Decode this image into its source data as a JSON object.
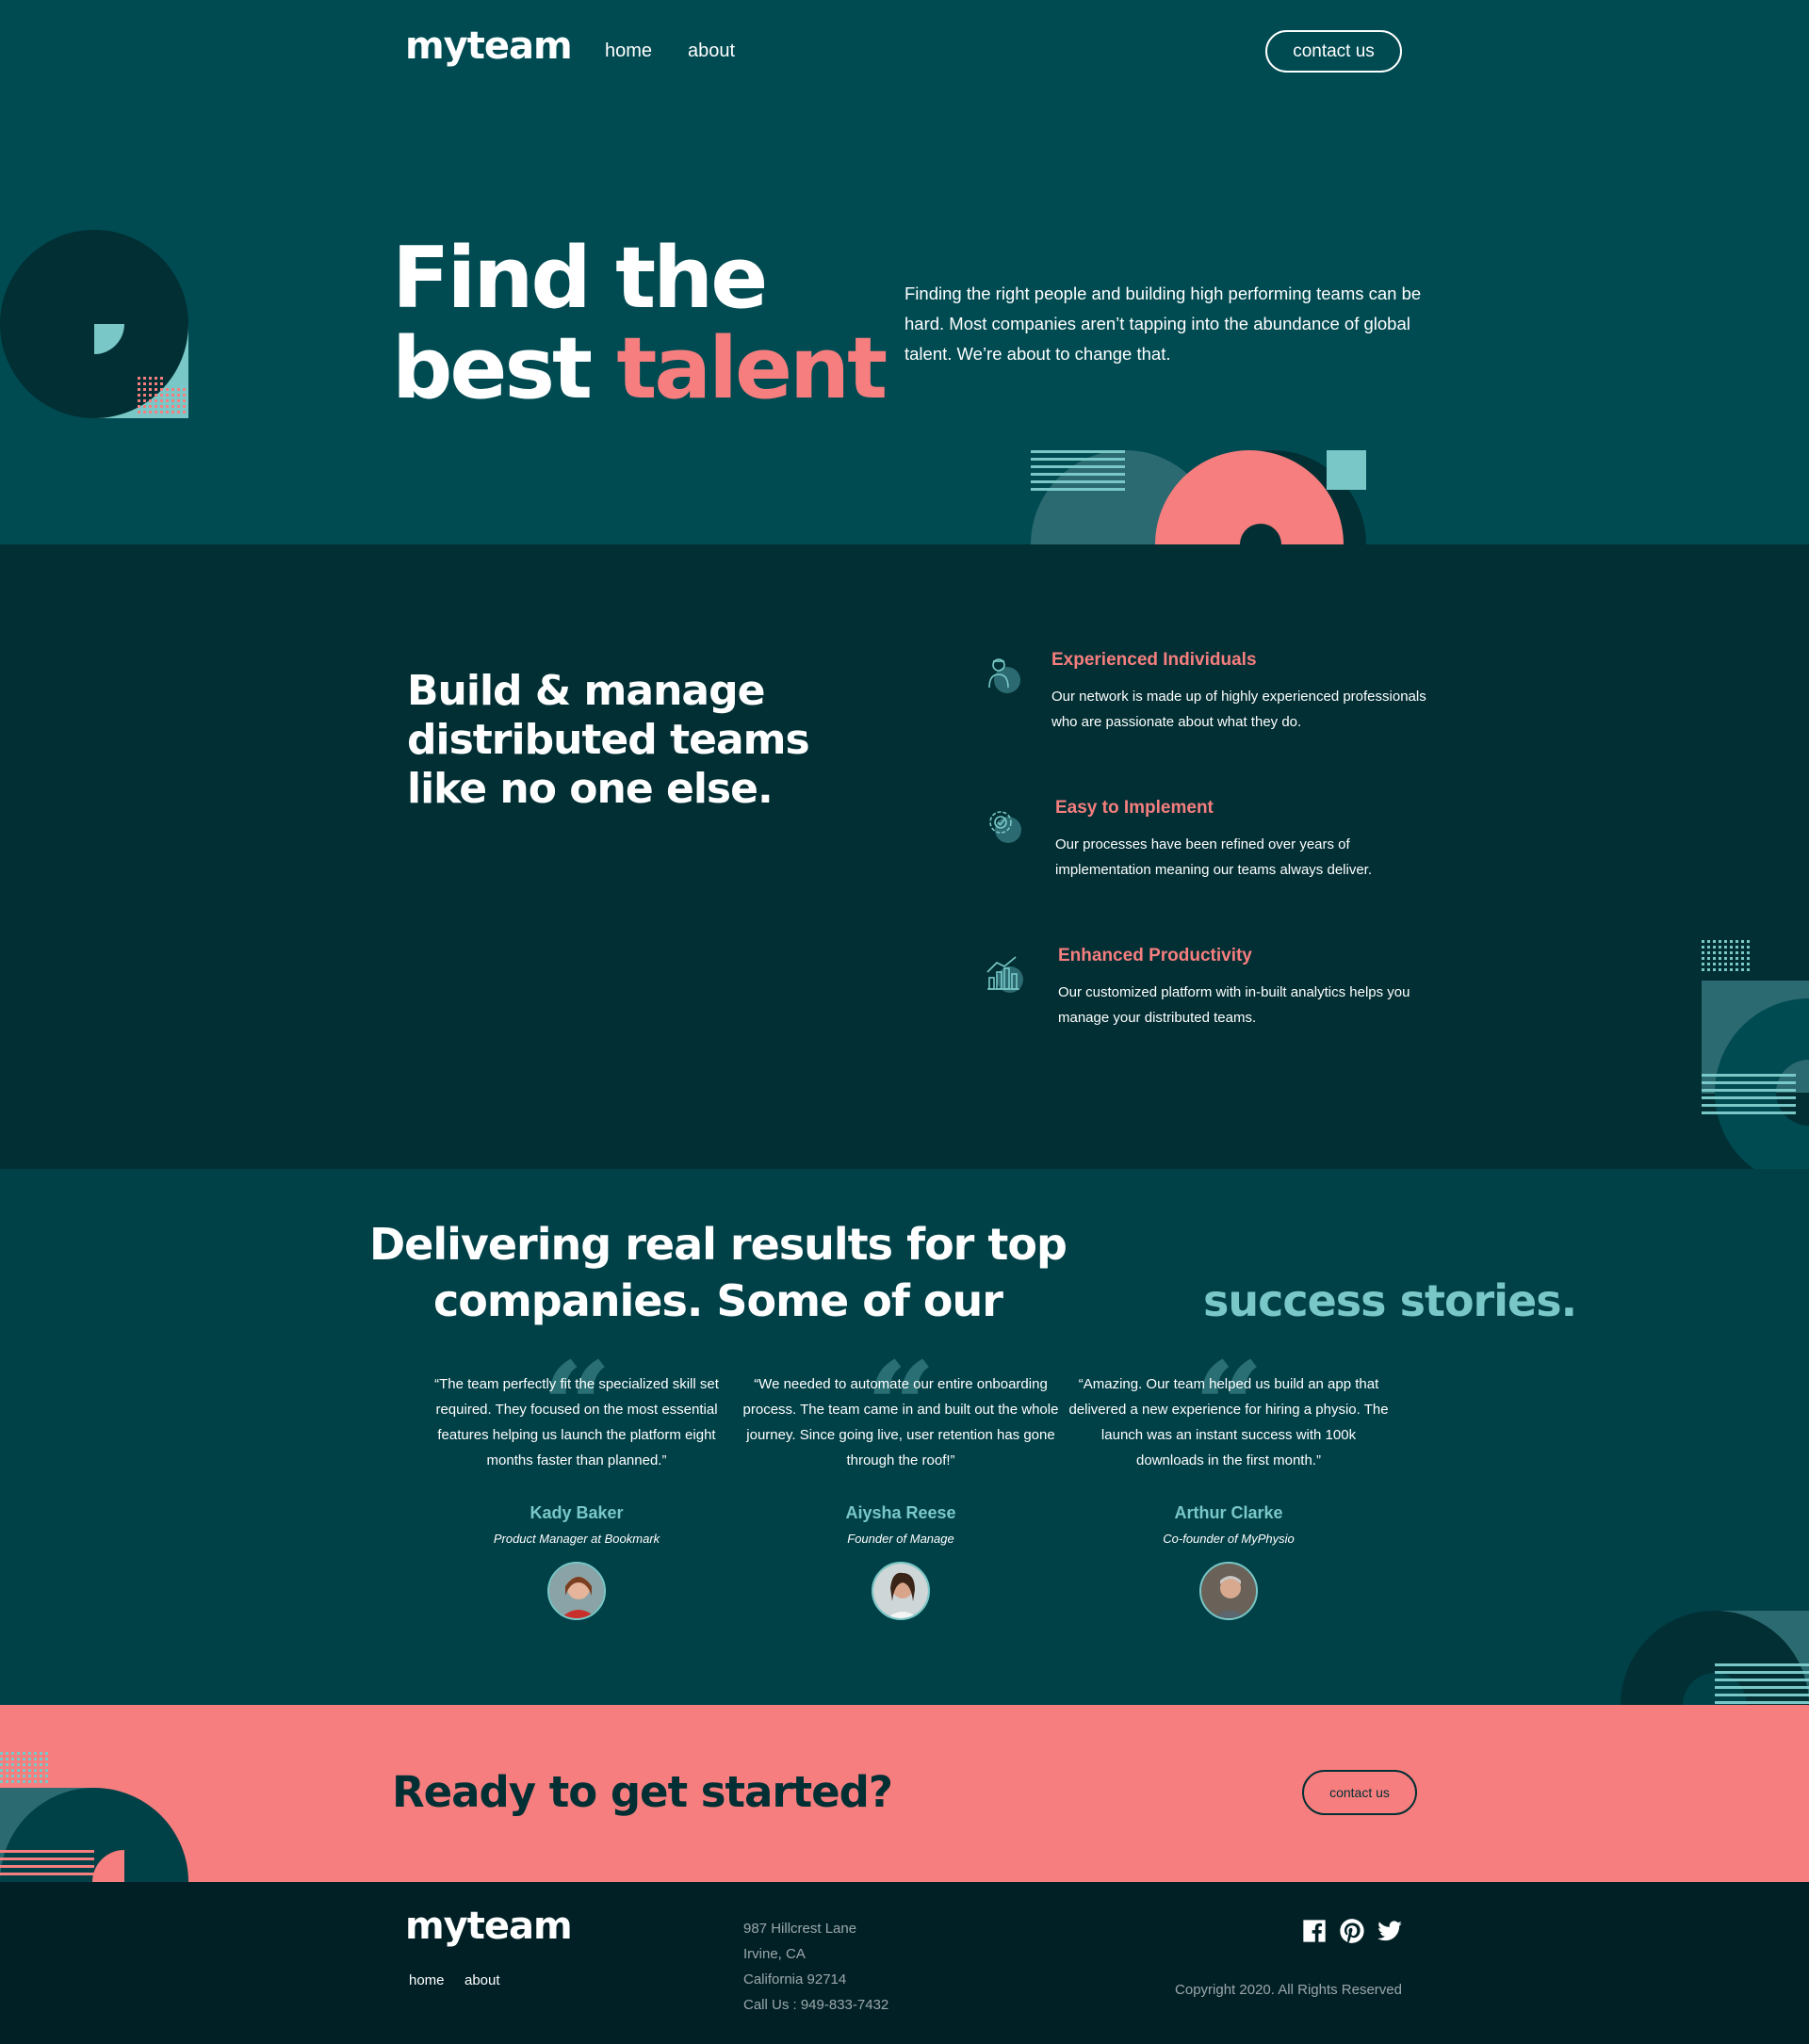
{
  "header": {
    "logo": "myteam",
    "nav": [
      {
        "label": "home"
      },
      {
        "label": "about"
      }
    ],
    "contact_label": "contact us"
  },
  "hero": {
    "title_line1": "Find the",
    "title_line2_prefix": "best ",
    "title_line2_accent": "talent",
    "description": "Finding the right people and building high performing teams can be hard. Most companies aren’t tapping into the abundance of global talent. We’re about to change that."
  },
  "features": {
    "title": "Build & manage distributed teams like no one else.",
    "items": [
      {
        "icon": "person-icon",
        "title": "Experienced Individuals",
        "text": "Our network is made up of highly experienced professionals who are passionate about what they do."
      },
      {
        "icon": "gear-icon",
        "title": "Easy to Implement",
        "text": "Our processes have been refined over years of implementation meaning our teams always deliver."
      },
      {
        "icon": "chart-icon",
        "title": "Enhanced Productivity",
        "text": "Our customized platform with in-built analytics helps you manage your distributed teams."
      }
    ]
  },
  "stories": {
    "title_prefix": "Delivering real results for top companies. Some of our ",
    "title_accent": "success stories.",
    "testimonials": [
      {
        "quote": "“The team perfectly fit the specialized skill set required. They focused on the most essential features helping us launch the platform eight months faster than planned.”",
        "name": "Kady Baker",
        "role": "Product Manager at Bookmark"
      },
      {
        "quote": "“We needed to automate our entire onboarding process. The team came in and built out the whole journey. Since going live, user retention has gone through the roof!”",
        "name": "Aiysha Reese",
        "role": "Founder of Manage"
      },
      {
        "quote": "“Amazing. Our team helped us build an app that delivered a new experience for hiring a physio. The launch was an instant success with 100k downloads in the first month.”",
        "name": "Arthur Clarke",
        "role": "Co-founder of MyPhysio"
      }
    ]
  },
  "cta": {
    "title": "Ready to get started?",
    "button_label": "contact us"
  },
  "footer": {
    "logo": "myteam",
    "nav": [
      {
        "label": "home"
      },
      {
        "label": "about"
      }
    ],
    "address": [
      "987 Hillcrest Lane",
      "Irvine, CA",
      "California 92714",
      "Call Us : 949-833-7432"
    ],
    "social": [
      "facebook-icon",
      "pinterest-icon",
      "twitter-icon"
    ],
    "copyright": "Copyright 2020. All Rights Reserved"
  },
  "colors": {
    "accent_coral": "#f67e7e",
    "accent_teal": "#79c8c7",
    "hero_bg": "#004b52",
    "features_bg": "#012f34",
    "footer_bg": "#012026"
  }
}
